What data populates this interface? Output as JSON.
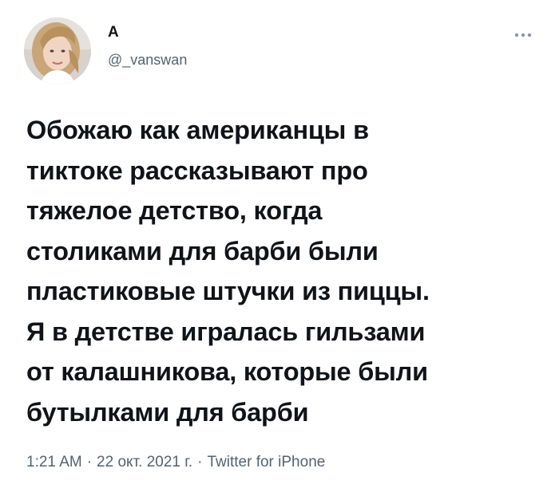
{
  "author": {
    "display_name": "А",
    "handle": "@_vanswan"
  },
  "tweet": {
    "lines": [
      "Обожаю как американцы в",
      "тиктоке рассказывают про",
      "тяжелое детство, когда",
      "столиками для барби были",
      "пластиковые штучки из пиццы.",
      "Я в детстве игралась гильзами",
      "от калашникова, которые были",
      "бутылками для барби"
    ]
  },
  "meta": {
    "time": "1:21 AM",
    "separator": "·",
    "date": "22 окт. 2021 г.",
    "source": "Twitter for iPhone"
  },
  "icons": {
    "more": "more-options-icon",
    "avatar": "avatar"
  },
  "colors": {
    "text": "#0f1419",
    "secondary": "#536471",
    "background": "#ffffff"
  }
}
